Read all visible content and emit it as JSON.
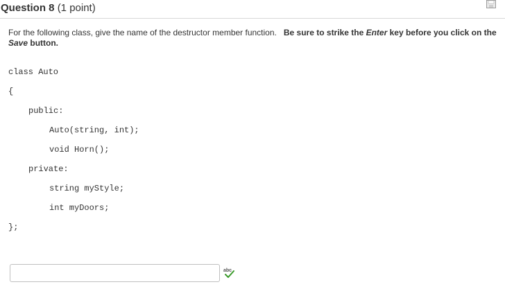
{
  "question": {
    "name": "Question 8",
    "points": "(1 point)"
  },
  "prompt": {
    "plain": "For the following class, give the name of the destructor member function.",
    "bold_part1": "Be sure to strike the ",
    "bold_italic_enter": "Enter",
    "bold_part2": " key before you click on the ",
    "bold_italic_save": "Save",
    "bold_part3": " button."
  },
  "code_lines": [
    "class Auto",
    "{",
    "public:",
    "Auto(string, int);",
    "void Horn();",
    "private:",
    "string myStyle;",
    "int myDoors;",
    "};"
  ],
  "answer": {
    "value": "",
    "placeholder": ""
  },
  "icons": {
    "save": "save-icon",
    "spellcheck": "spellcheck-icon"
  },
  "colors": {
    "text": "#333333",
    "border": "#bfbfbf",
    "spellcheck_check": "#3a9a2a"
  }
}
